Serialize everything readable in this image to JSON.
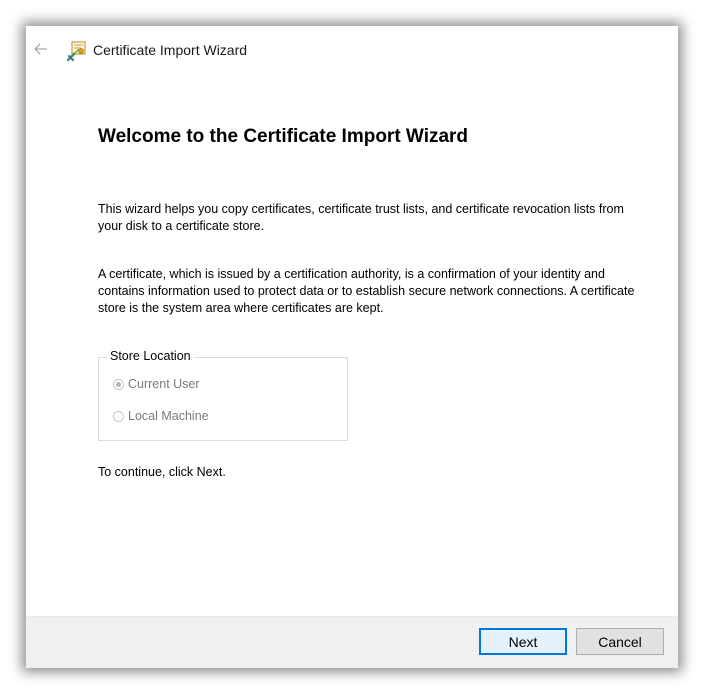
{
  "window": {
    "title": "Certificate Import Wizard",
    "back_icon": "back-arrow-icon",
    "title_icon": "certificate-icon"
  },
  "main": {
    "heading": "Welcome to the Certificate Import Wizard",
    "paragraph1": "This wizard helps you copy certificates, certificate trust lists, and certificate revocation lists from your disk to a certificate store.",
    "paragraph2": "A certificate, which is issued by a certification authority, is a confirmation of your identity and contains information used to protect data or to establish secure network connections. A certificate store is the system area where certificates are kept.",
    "store_location": {
      "legend": "Store Location",
      "options": [
        {
          "label": "Current User",
          "selected": true,
          "enabled": false
        },
        {
          "label": "Local Machine",
          "selected": false,
          "enabled": false
        }
      ]
    },
    "continue_text": "To continue, click Next."
  },
  "footer": {
    "next_label": "Next",
    "cancel_label": "Cancel"
  },
  "colors": {
    "accent": "#0078d7",
    "footer_bg": "#f0f0f0",
    "disabled_text": "#7a7a7a"
  }
}
